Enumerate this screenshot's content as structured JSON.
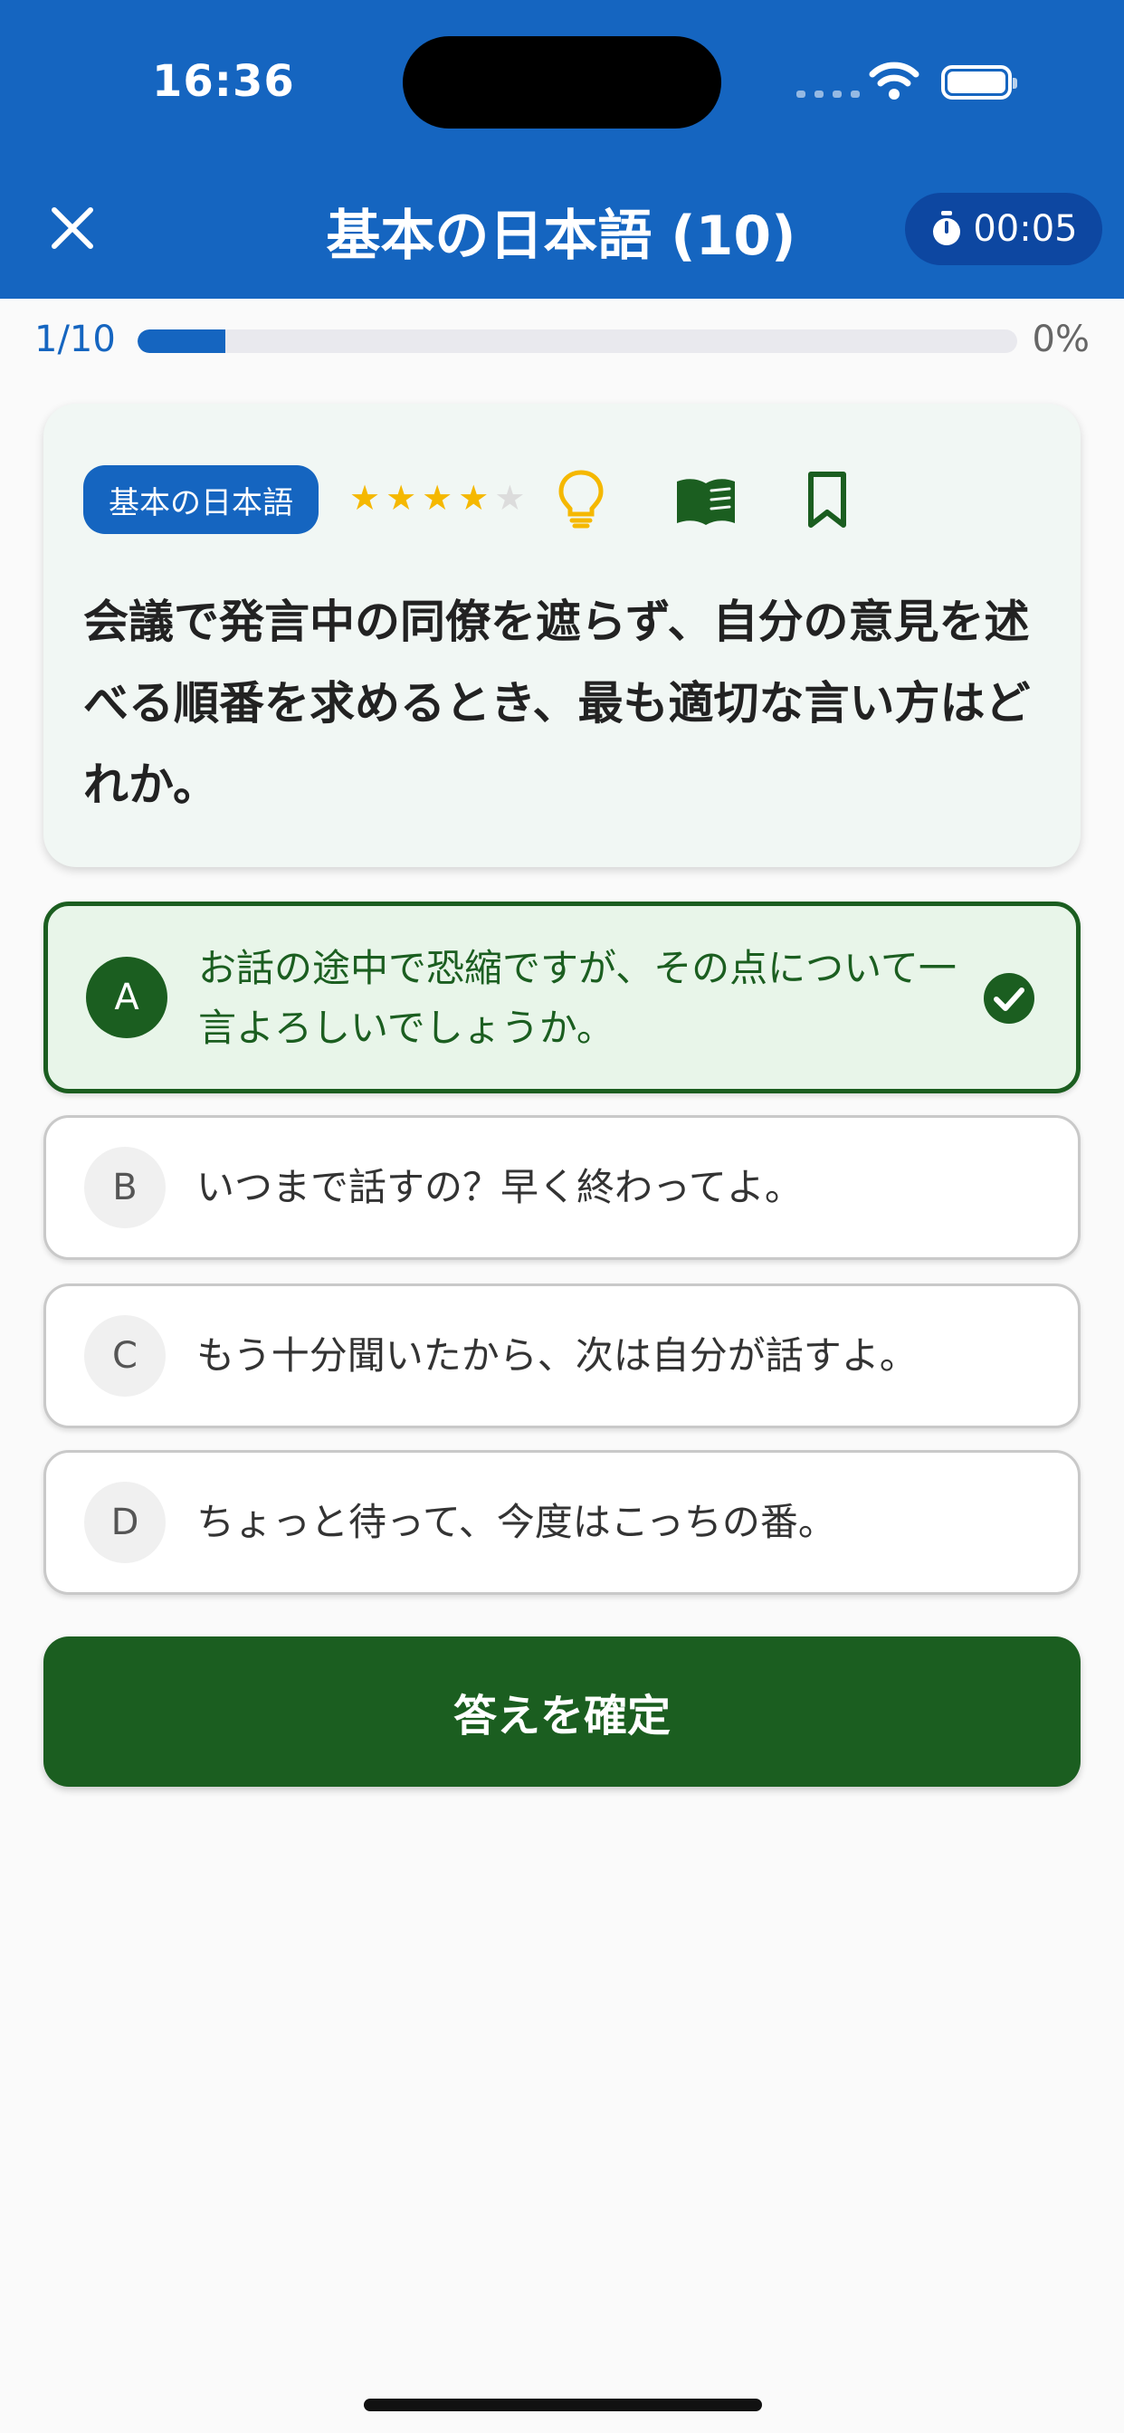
{
  "status_bar": {
    "time": "16:36"
  },
  "header": {
    "title": "基本の日本語 (10)",
    "timer": "00:05",
    "color": "#1565c0"
  },
  "progress": {
    "count": "1/10",
    "percent_label": "0%",
    "fill_fraction": 0.1
  },
  "question": {
    "category": "基本の日本語",
    "difficulty_stars": 4,
    "max_stars": 5,
    "text": "会議で発言中の同僚を遮らず、自分の意見を述べる順番を求めるとき、最も適切な言い方はどれか。",
    "icons": [
      "lightbulb-icon",
      "book-icon",
      "bookmark-icon"
    ]
  },
  "options": [
    {
      "letter": "A",
      "text": "お話の途中で恐縮ですが、その点について一言よろしいでしょうか。",
      "selected": true
    },
    {
      "letter": "B",
      "text": "いつまで話すの？早く終わってよ。",
      "selected": false
    },
    {
      "letter": "C",
      "text": "もう十分聞いたから、次は自分が話すよ。",
      "selected": false
    },
    {
      "letter": "D",
      "text": "ちょっと待って、今度はこっちの番。",
      "selected": false
    }
  ],
  "confirm_button": {
    "label": "答えを確定",
    "color": "#1b5e20"
  }
}
